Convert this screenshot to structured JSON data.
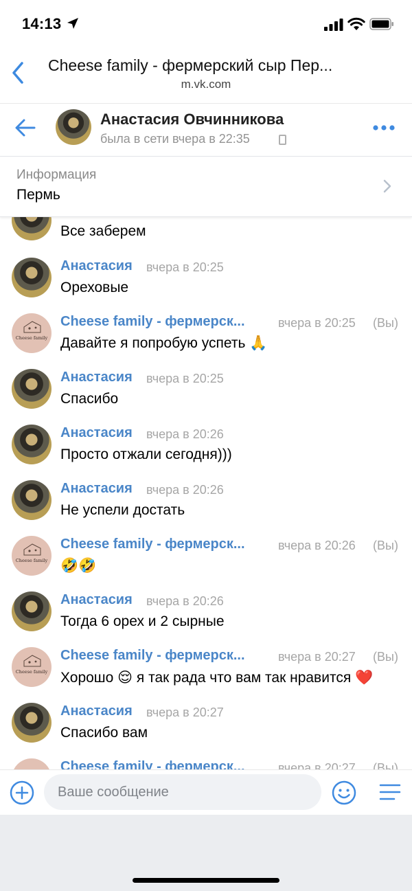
{
  "status_bar": {
    "time": "14:13"
  },
  "browser": {
    "title": "Cheese family - фермерский сыр Пер...",
    "url": "m.vk.com"
  },
  "chat_header": {
    "name": "Анастасия Овчинникова",
    "status": "была в сети вчера в 22:35"
  },
  "info": {
    "label": "Информация",
    "value": "Пермь"
  },
  "messages": [
    {
      "author": "",
      "time": "",
      "text": "Все заберем",
      "avatar": "person"
    },
    {
      "author": "Анастасия",
      "time": "вчера в 20:25",
      "text": "Ореховые",
      "avatar": "person"
    },
    {
      "author": "Cheese family - фермерск...",
      "time": "вчера в 20:25",
      "you": "(Вы)",
      "text": "Давайте я попробую успеть 🙏",
      "avatar": "cheese"
    },
    {
      "author": "Анастасия",
      "time": "вчера в 20:25",
      "text": "Спасибо",
      "avatar": "person"
    },
    {
      "author": "Анастасия",
      "time": "вчера в 20:26",
      "text": "Просто отжали сегодня)))",
      "avatar": "person"
    },
    {
      "author": "Анастасия",
      "time": "вчера в 20:26",
      "text": "Не успели достать",
      "avatar": "person"
    },
    {
      "author": "Cheese family - фермерск...",
      "time": "вчера в 20:26",
      "you": "(Вы)",
      "text": "🤣🤣",
      "avatar": "cheese"
    },
    {
      "author": "Анастасия",
      "time": "вчера в 20:26",
      "text": "Тогда 6 орех и 2 сырные",
      "avatar": "person"
    },
    {
      "author": "Cheese family - фермерск...",
      "time": "вчера в 20:27",
      "you": "(Вы)",
      "text": "Хорошо 😌 я так рада что вам так нравится ❤️",
      "avatar": "cheese"
    },
    {
      "author": "Анастасия",
      "time": "вчера в 20:27",
      "text": "Спасибо вам",
      "avatar": "person"
    },
    {
      "author": "Cheese family - фермерск...",
      "time": "вчера в 20:27",
      "you": "(Вы)",
      "text": "",
      "avatar": "cheese"
    }
  ],
  "avatar_label": "Cheese family",
  "composer": {
    "placeholder": "Ваше сообщение"
  },
  "colors": {
    "accent": "#4a86c8",
    "meta": "#a6a6a6",
    "input_bg": "#f0f2f5",
    "footer_bg": "#ebedf0"
  },
  "icons": [
    "location-arrow-icon",
    "signal-icon",
    "wifi-icon",
    "battery-icon",
    "chevron-left-icon",
    "arrow-left-icon",
    "more-dots-icon",
    "chevron-right-icon",
    "plus-circle-icon",
    "smile-icon",
    "menu-lines-icon",
    "phone-device-icon"
  ]
}
